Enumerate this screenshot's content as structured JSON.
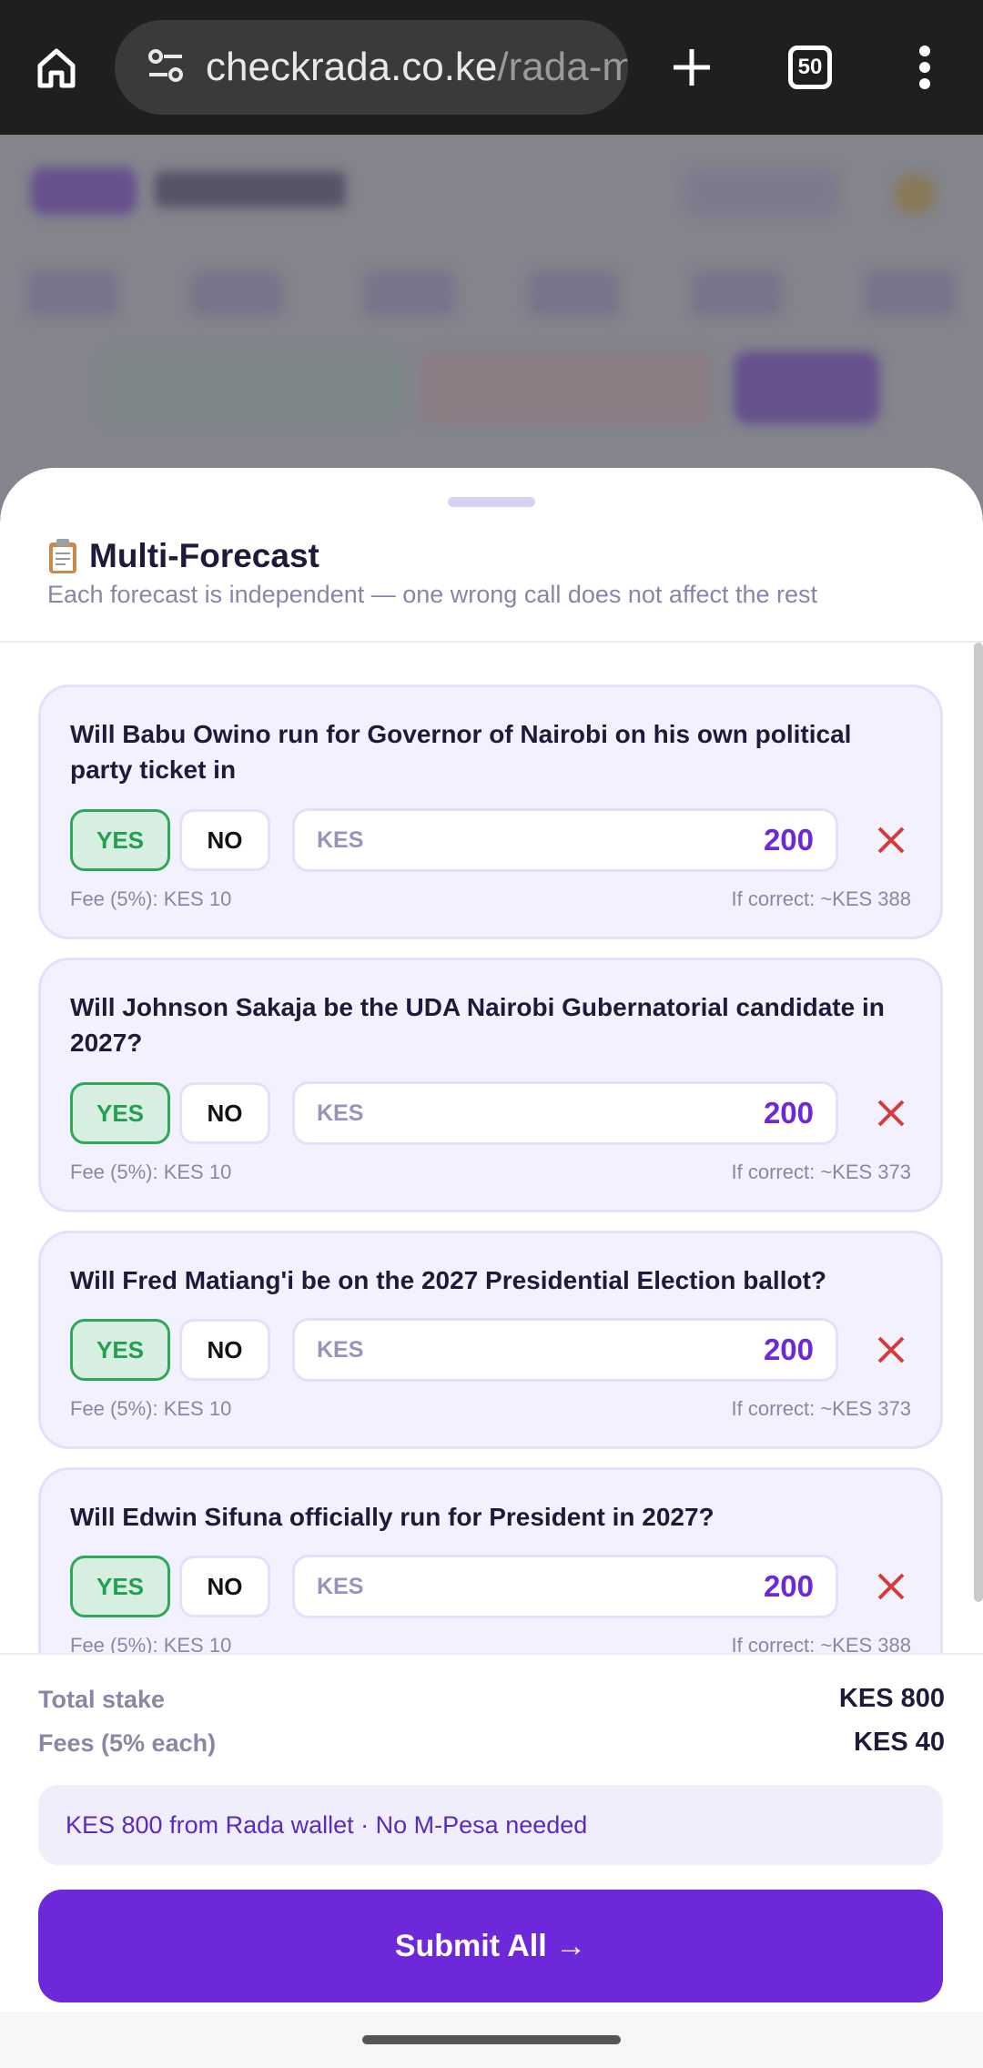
{
  "browser": {
    "url_host": "checkrada.co.ke",
    "url_path": "/rada-m",
    "tab_count": "50"
  },
  "sheet": {
    "title": "Multi-Forecast",
    "subtitle": "Each forecast is independent — one wrong call does not affect the rest"
  },
  "forecasts": [
    {
      "question": "Will Babu Owino run for Governor of Nairobi on his own political party ticket in",
      "yes_label": "YES",
      "no_label": "NO",
      "currency": "KES",
      "amount": "200",
      "fee": "Fee (5%): KES 10",
      "if_correct": "If correct: ~KES 388"
    },
    {
      "question": "Will Johnson Sakaja be the UDA Nairobi Gubernatorial candidate in 2027?",
      "yes_label": "YES",
      "no_label": "NO",
      "currency": "KES",
      "amount": "200",
      "fee": "Fee (5%): KES 10",
      "if_correct": "If correct: ~KES 373"
    },
    {
      "question": "Will Fred Matiang'i be on the 2027 Presidential Election ballot?",
      "yes_label": "YES",
      "no_label": "NO",
      "currency": "KES",
      "amount": "200",
      "fee": "Fee (5%): KES 10",
      "if_correct": "If correct: ~KES 373"
    },
    {
      "question": "Will Edwin Sifuna officially run for President in 2027?",
      "yes_label": "YES",
      "no_label": "NO",
      "currency": "KES",
      "amount": "200",
      "fee": "Fee (5%): KES 10",
      "if_correct": "If correct: ~KES 388"
    }
  ],
  "summary": {
    "total_label": "Total stake",
    "total_value": "KES 800",
    "fees_label": "Fees (5% each)",
    "fees_value": "KES 40",
    "wallet_note": "KES 800 from Rada wallet · No M-Pesa needed",
    "submit_label": "Submit All →"
  },
  "colors": {
    "accent": "#6d28d9",
    "yes_green": "#22a052",
    "remove_red": "#d63a3a"
  }
}
